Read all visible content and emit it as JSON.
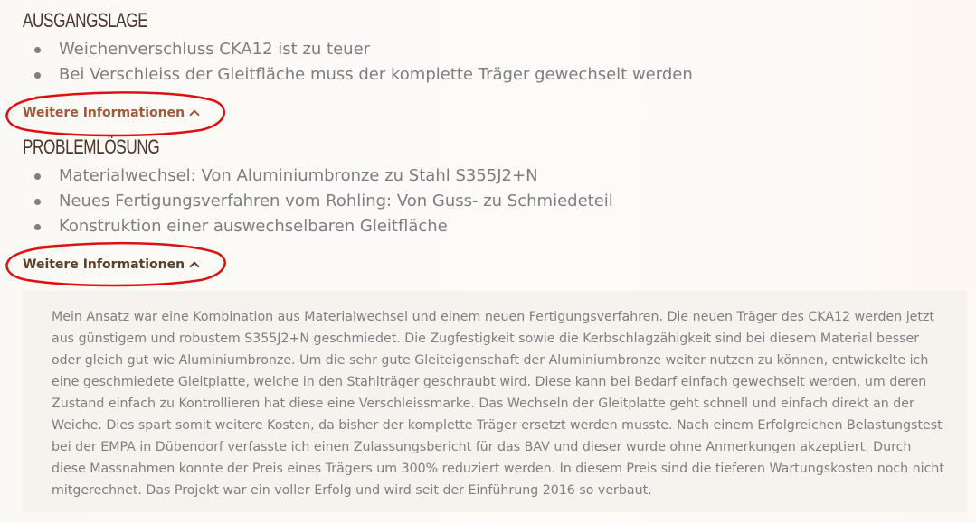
{
  "sections": [
    {
      "heading": "AUSGANGSLAGE",
      "bullets": [
        "Weichenverschluss CKA12 ist zu teuer",
        "Bei Verschleiss der Gleitfläche muss der komplette Träger gewechselt werden"
      ],
      "more_label": "Weitere Informationen"
    },
    {
      "heading": "PROBLEMLÖSUNG",
      "bullets": [
        "Materialwechsel: Von Aluminiumbronze zu Stahl S355J2+N",
        "Neues Fertigungsverfahren vom Rohling: Von Guss- zu Schmiedeteil",
        "Konstruktion einer auswechselbaren Gleitfläche"
      ],
      "more_label": "Weitere Informationen"
    }
  ],
  "details": {
    "text": "Mein Ansatz war eine Kombination aus Materialwechsel und einem neuen Fertigungsverfahren. Die neuen Träger des CKA12 werden jetzt aus günstigem und robustem S355J2+N geschmiedet. Die Zugfestigkeit sowie die Kerbschlagzähigkeit sind bei diesem Material besser oder gleich gut wie Aluminiumbronze. Um die sehr gute Gleiteigenschaft der Aluminiumbronze weiter nutzen zu können, entwickelte ich eine geschmiedete Gleitplatte, welche in den Stahlträger geschraubt wird. Diese kann bei Bedarf einfach gewechselt werden, um deren Zustand einfach zu Kontrollieren hat diese eine Verschleissmarke. Das Wechseln der Gleitplatte geht schnell und einfach direkt an der Weiche. Dies spart somit weitere Kosten, da bisher der komplette Träger ersetzt werden musste. Nach einem Erfolgreichen Belastungstest bei der EMPA in Dübendorf verfasste ich einen Zulassungsbericht für das BAV und dieser wurde ohne Anmerkungen akzeptiert. Durch diese Massnahmen konnte der Preis eines Trägers um 300% reduziert werden. In diesem Preis sind die tieferen Wartungskosten noch nicht mitgerechnet. Das Projekt war ein voller Erfolg und wird seit der Einführung 2016 so verbaut."
  },
  "colors": {
    "heading": "#4a3526",
    "bullet_text": "#7e7d80",
    "link_primary": "#a5573a",
    "link_secondary": "#5b3e2c",
    "panel_bg": "#f6f2ee",
    "annotation_red": "#e01010"
  },
  "icons": {
    "expand_toggle": "chevron-up-icon"
  }
}
